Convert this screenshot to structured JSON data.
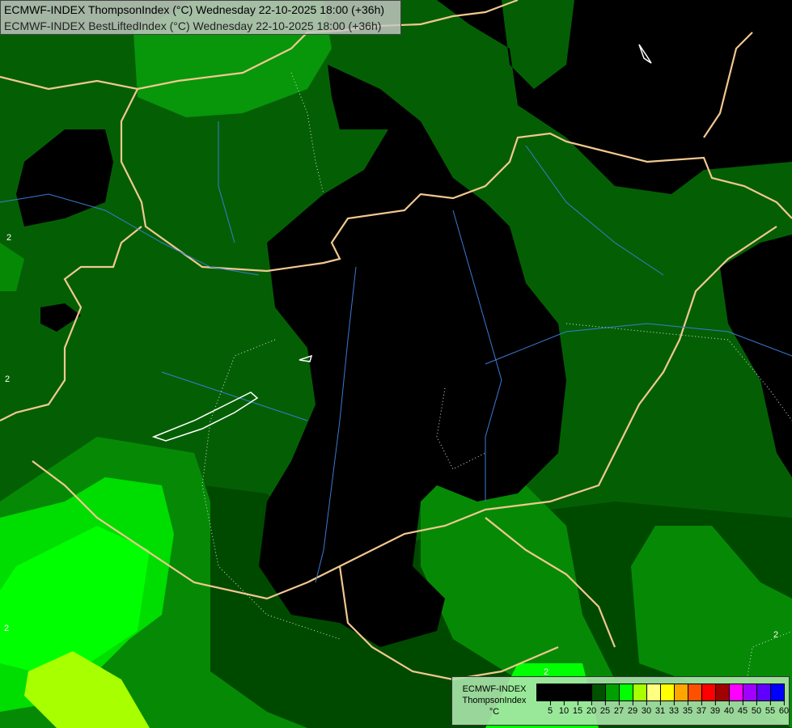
{
  "header": {
    "line1": "ECMWF-INDEX ThompsonIndex (°C) Wednesday 22-10-2025 18:00 (+36h)",
    "line2": "ECMWF-INDEX BestLiftedIndex (°C) Wednesday 22-10-2025 18:00 (+36h)"
  },
  "legend": {
    "title": "ECMWF-INDEX",
    "variable": "ThompsonIndex",
    "unit": "°C",
    "colors": [
      "#000000",
      "#000000",
      "#000000",
      "#000000",
      "#005000",
      "#00a000",
      "#00ff00",
      "#a8ff00",
      "#ffff80",
      "#ffff00",
      "#ffa500",
      "#ff5000",
      "#ff0000",
      "#a00000",
      "#ff00ff",
      "#a000ff",
      "#6000ff",
      "#0000ff"
    ],
    "ticks": [
      "5",
      "10",
      "15",
      "20",
      "25",
      "27",
      "29",
      "30",
      "31",
      "33",
      "35",
      "37",
      "39",
      "40",
      "45",
      "50",
      "55",
      "60"
    ]
  },
  "contour_labels": [
    "2",
    "2",
    "2",
    "2",
    "2"
  ]
}
